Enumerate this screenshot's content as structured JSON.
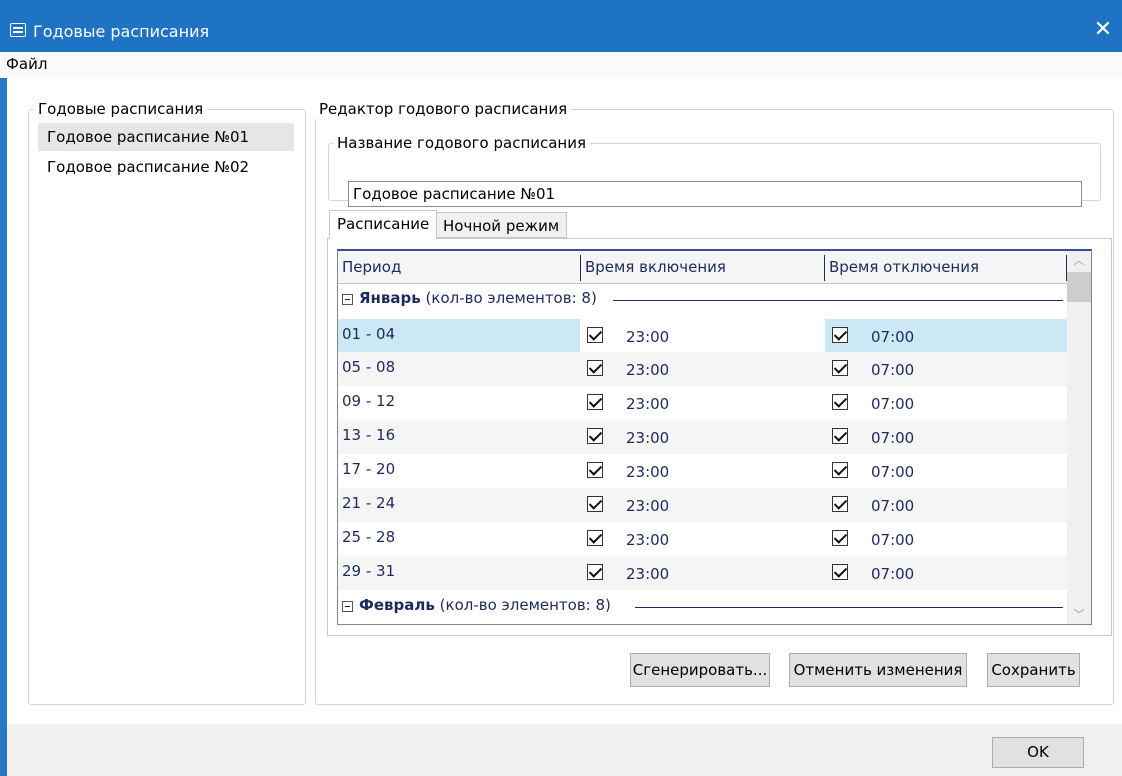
{
  "window": {
    "title": "Годовые расписания",
    "close_glyph": "✕",
    "icon": "window-app-icon"
  },
  "menubar": {
    "items": [
      {
        "label": "Файл"
      }
    ]
  },
  "schedules_panel": {
    "legend": "Годовые расписания",
    "items": [
      {
        "label": "Годовое расписание №01",
        "selected": true
      },
      {
        "label": "Годовое расписание №02",
        "selected": false
      }
    ]
  },
  "editor": {
    "legend": "Редактор годового расписания",
    "name_group": {
      "legend": "Название годового расписания",
      "value": "Годовое расписание №01"
    },
    "tabs": [
      {
        "label": "Расписание",
        "active": true
      },
      {
        "label": "Ночной режим",
        "active": false
      }
    ],
    "grid": {
      "columns": [
        "Период",
        "Время включения",
        "Время отключения"
      ],
      "groups": [
        {
          "name": "Январь",
          "count_text": "(кол-во элементов: 8)",
          "rows": [
            {
              "period": "01 - 04",
              "on_checked": true,
              "on_time": "23:00",
              "off_checked": true,
              "off_time": "07:00",
              "selected": true
            },
            {
              "period": "05 - 08",
              "on_checked": true,
              "on_time": "23:00",
              "off_checked": true,
              "off_time": "07:00"
            },
            {
              "period": "09 - 12",
              "on_checked": true,
              "on_time": "23:00",
              "off_checked": true,
              "off_time": "07:00"
            },
            {
              "period": "13 - 16",
              "on_checked": true,
              "on_time": "23:00",
              "off_checked": true,
              "off_time": "07:00"
            },
            {
              "period": "17 - 20",
              "on_checked": true,
              "on_time": "23:00",
              "off_checked": true,
              "off_time": "07:00"
            },
            {
              "period": "21 - 24",
              "on_checked": true,
              "on_time": "23:00",
              "off_checked": true,
              "off_time": "07:00"
            },
            {
              "period": "25 - 28",
              "on_checked": true,
              "on_time": "23:00",
              "off_checked": true,
              "off_time": "07:00"
            },
            {
              "period": "29 - 31",
              "on_checked": true,
              "on_time": "23:00",
              "off_checked": true,
              "off_time": "07:00"
            }
          ]
        },
        {
          "name": "Февраль",
          "count_text": "(кол-во элементов: 8)",
          "rows": []
        }
      ]
    },
    "buttons": {
      "generate": "Сгенерировать...",
      "cancel": "Отменить изменения",
      "save": "Сохранить"
    }
  },
  "footer": {
    "ok": "OK"
  },
  "colors": {
    "titlebar": "#1f73c4",
    "selection": "#cce8f4",
    "grid_text": "#1e2a5e"
  }
}
